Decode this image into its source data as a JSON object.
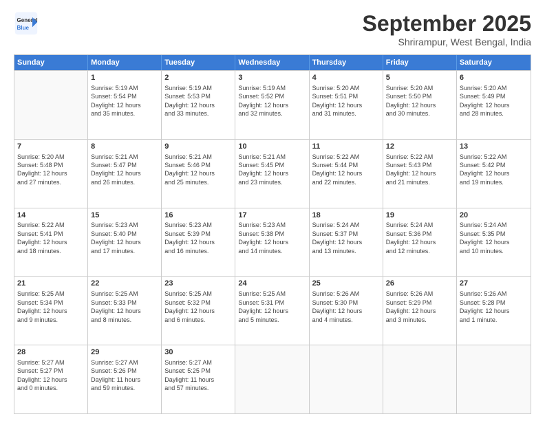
{
  "header": {
    "logo_general": "General",
    "logo_blue": "Blue",
    "main_title": "September 2025",
    "sub_title": "Shrirampur, West Bengal, India"
  },
  "calendar": {
    "headers": [
      "Sunday",
      "Monday",
      "Tuesday",
      "Wednesday",
      "Thursday",
      "Friday",
      "Saturday"
    ],
    "weeks": [
      [
        {
          "day": "",
          "info": ""
        },
        {
          "day": "1",
          "info": "Sunrise: 5:19 AM\nSunset: 5:54 PM\nDaylight: 12 hours\nand 35 minutes."
        },
        {
          "day": "2",
          "info": "Sunrise: 5:19 AM\nSunset: 5:53 PM\nDaylight: 12 hours\nand 33 minutes."
        },
        {
          "day": "3",
          "info": "Sunrise: 5:19 AM\nSunset: 5:52 PM\nDaylight: 12 hours\nand 32 minutes."
        },
        {
          "day": "4",
          "info": "Sunrise: 5:20 AM\nSunset: 5:51 PM\nDaylight: 12 hours\nand 31 minutes."
        },
        {
          "day": "5",
          "info": "Sunrise: 5:20 AM\nSunset: 5:50 PM\nDaylight: 12 hours\nand 30 minutes."
        },
        {
          "day": "6",
          "info": "Sunrise: 5:20 AM\nSunset: 5:49 PM\nDaylight: 12 hours\nand 28 minutes."
        }
      ],
      [
        {
          "day": "7",
          "info": "Sunrise: 5:20 AM\nSunset: 5:48 PM\nDaylight: 12 hours\nand 27 minutes."
        },
        {
          "day": "8",
          "info": "Sunrise: 5:21 AM\nSunset: 5:47 PM\nDaylight: 12 hours\nand 26 minutes."
        },
        {
          "day": "9",
          "info": "Sunrise: 5:21 AM\nSunset: 5:46 PM\nDaylight: 12 hours\nand 25 minutes."
        },
        {
          "day": "10",
          "info": "Sunrise: 5:21 AM\nSunset: 5:45 PM\nDaylight: 12 hours\nand 23 minutes."
        },
        {
          "day": "11",
          "info": "Sunrise: 5:22 AM\nSunset: 5:44 PM\nDaylight: 12 hours\nand 22 minutes."
        },
        {
          "day": "12",
          "info": "Sunrise: 5:22 AM\nSunset: 5:43 PM\nDaylight: 12 hours\nand 21 minutes."
        },
        {
          "day": "13",
          "info": "Sunrise: 5:22 AM\nSunset: 5:42 PM\nDaylight: 12 hours\nand 19 minutes."
        }
      ],
      [
        {
          "day": "14",
          "info": "Sunrise: 5:22 AM\nSunset: 5:41 PM\nDaylight: 12 hours\nand 18 minutes."
        },
        {
          "day": "15",
          "info": "Sunrise: 5:23 AM\nSunset: 5:40 PM\nDaylight: 12 hours\nand 17 minutes."
        },
        {
          "day": "16",
          "info": "Sunrise: 5:23 AM\nSunset: 5:39 PM\nDaylight: 12 hours\nand 16 minutes."
        },
        {
          "day": "17",
          "info": "Sunrise: 5:23 AM\nSunset: 5:38 PM\nDaylight: 12 hours\nand 14 minutes."
        },
        {
          "day": "18",
          "info": "Sunrise: 5:24 AM\nSunset: 5:37 PM\nDaylight: 12 hours\nand 13 minutes."
        },
        {
          "day": "19",
          "info": "Sunrise: 5:24 AM\nSunset: 5:36 PM\nDaylight: 12 hours\nand 12 minutes."
        },
        {
          "day": "20",
          "info": "Sunrise: 5:24 AM\nSunset: 5:35 PM\nDaylight: 12 hours\nand 10 minutes."
        }
      ],
      [
        {
          "day": "21",
          "info": "Sunrise: 5:25 AM\nSunset: 5:34 PM\nDaylight: 12 hours\nand 9 minutes."
        },
        {
          "day": "22",
          "info": "Sunrise: 5:25 AM\nSunset: 5:33 PM\nDaylight: 12 hours\nand 8 minutes."
        },
        {
          "day": "23",
          "info": "Sunrise: 5:25 AM\nSunset: 5:32 PM\nDaylight: 12 hours\nand 6 minutes."
        },
        {
          "day": "24",
          "info": "Sunrise: 5:25 AM\nSunset: 5:31 PM\nDaylight: 12 hours\nand 5 minutes."
        },
        {
          "day": "25",
          "info": "Sunrise: 5:26 AM\nSunset: 5:30 PM\nDaylight: 12 hours\nand 4 minutes."
        },
        {
          "day": "26",
          "info": "Sunrise: 5:26 AM\nSunset: 5:29 PM\nDaylight: 12 hours\nand 3 minutes."
        },
        {
          "day": "27",
          "info": "Sunrise: 5:26 AM\nSunset: 5:28 PM\nDaylight: 12 hours\nand 1 minute."
        }
      ],
      [
        {
          "day": "28",
          "info": "Sunrise: 5:27 AM\nSunset: 5:27 PM\nDaylight: 12 hours\nand 0 minutes."
        },
        {
          "day": "29",
          "info": "Sunrise: 5:27 AM\nSunset: 5:26 PM\nDaylight: 11 hours\nand 59 minutes."
        },
        {
          "day": "30",
          "info": "Sunrise: 5:27 AM\nSunset: 5:25 PM\nDaylight: 11 hours\nand 57 minutes."
        },
        {
          "day": "",
          "info": ""
        },
        {
          "day": "",
          "info": ""
        },
        {
          "day": "",
          "info": ""
        },
        {
          "day": "",
          "info": ""
        }
      ]
    ]
  }
}
